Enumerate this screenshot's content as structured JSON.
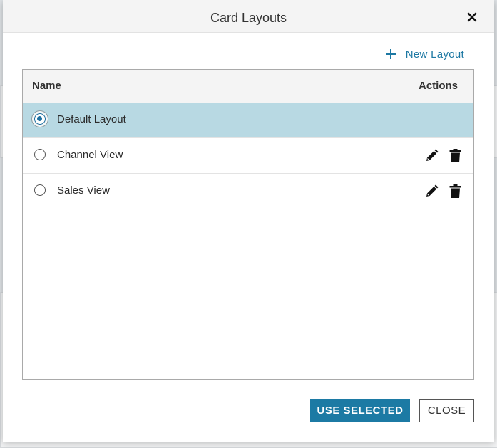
{
  "dialog": {
    "title": "Card Layouts",
    "close_icon": "close-icon",
    "new_layout_label": "New Layout",
    "new_layout_icon": "plus-icon"
  },
  "table": {
    "headers": {
      "name": "Name",
      "actions": "Actions"
    },
    "rows": [
      {
        "label": "Default Layout",
        "selected": true,
        "actions": []
      },
      {
        "label": "Channel View",
        "selected": false,
        "actions": [
          "edit-pencil-icon",
          "delete-trash-icon"
        ]
      },
      {
        "label": "Sales View",
        "selected": false,
        "actions": [
          "edit-pencil-icon",
          "delete-trash-icon"
        ]
      }
    ]
  },
  "footer": {
    "use_selected_label": "USE SELECTED",
    "close_label": "CLOSE"
  },
  "colors": {
    "accent": "#1c7aa4",
    "selected_row": "#b8d9e3",
    "header_bg": "#f4f4f4"
  }
}
